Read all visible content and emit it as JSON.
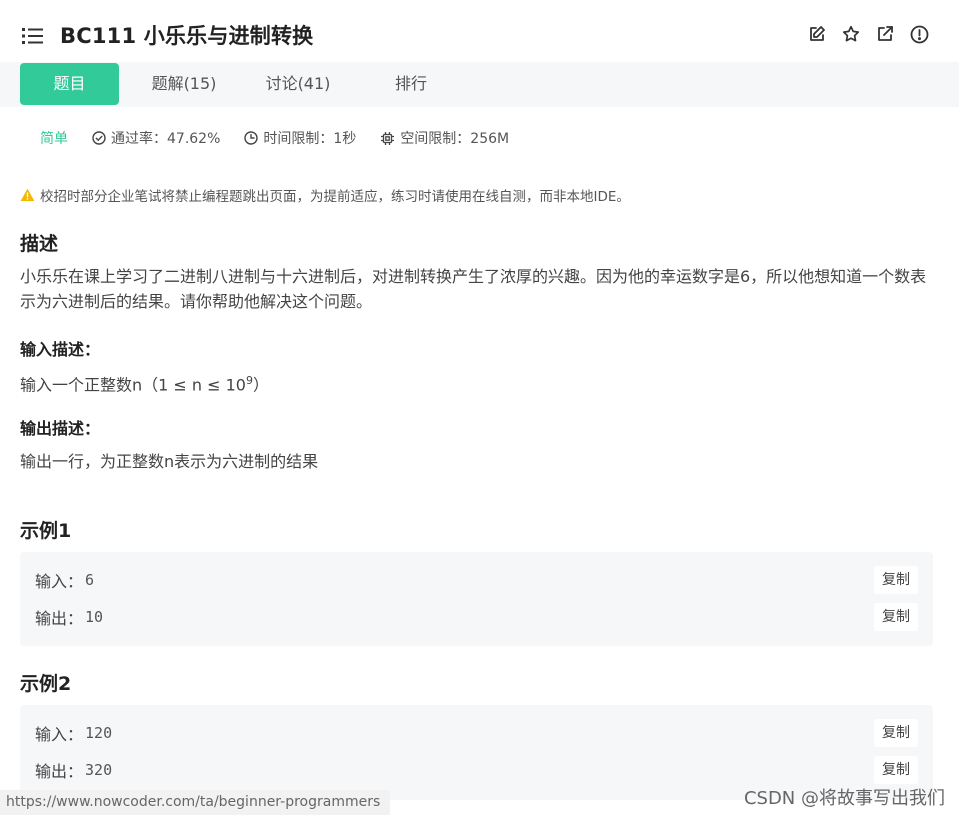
{
  "header": {
    "title": "BC111  小乐乐与进制转换",
    "icons": [
      "list-icon",
      "edit-icon",
      "star-icon",
      "external-link-icon",
      "alert-circle-icon"
    ]
  },
  "tabs": [
    {
      "label": "题目",
      "active": true
    },
    {
      "label": "题解(15)"
    },
    {
      "label": "讨论(41)"
    },
    {
      "label": "排行"
    }
  ],
  "meta": {
    "difficulty": "简单",
    "pass_rate": "通过率：47.62%",
    "time_limit": "时间限制：1秒",
    "space_limit": "空间限制：256M"
  },
  "notice": "校招时部分企业笔试将禁止编程题跳出页面，为提前适应，练习时请使用在线自测，而非本地IDE。",
  "description": {
    "heading": "描述",
    "text": "小乐乐在课上学习了二进制八进制与十六进制后，对进制转换产生了浓厚的兴趣。因为他的幸运数字是6，所以他想知道一个数表示为六进制后的结果。请你帮助他解决这个问题。"
  },
  "input_desc": {
    "heading": "输入描述：",
    "text_pre": "输入一个正整数n（1 ≤ n ≤ 10",
    "sup": "9",
    "text_post": "）"
  },
  "output_desc": {
    "heading": "输出描述：",
    "text": "输出一行，为正整数n表示为六进制的结果"
  },
  "examples": [
    {
      "heading": "示例1",
      "input_label": "输入：",
      "input": "6",
      "output_label": "输出：",
      "output": "10",
      "copy": "复制"
    },
    {
      "heading": "示例2",
      "input_label": "输入：",
      "input": "120",
      "output_label": "输出：",
      "output": "320",
      "copy": "复制"
    }
  ],
  "status_url": "https://www.nowcoder.com/ta/beginner-programmers",
  "watermark": "CSDN @将故事写出我们",
  "colors": {
    "accent": "#32ca99",
    "warning": "#f5b800"
  }
}
